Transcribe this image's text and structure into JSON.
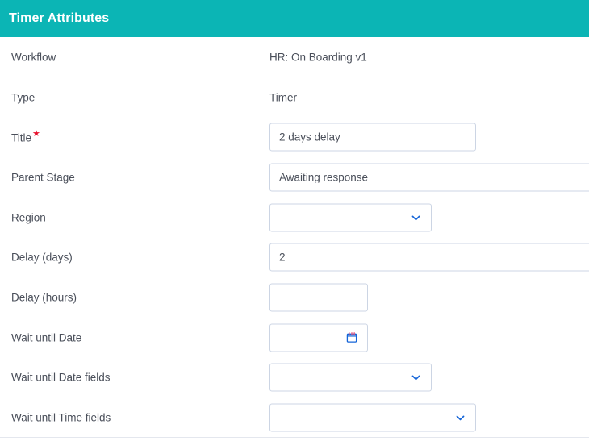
{
  "header": {
    "title": "Timer Attributes",
    "background_color": "#0bb5b5",
    "text_color": "#ffffff"
  },
  "colors": {
    "accent_teal": "#0bb5b5",
    "label_text": "#4a4f5a",
    "input_border": "#ccd5e4",
    "icon_blue": "#1565d8",
    "required_star": "#e8112d",
    "divider": "#e4e7ee"
  },
  "form": {
    "rows": [
      {
        "label": "Workflow",
        "required": false,
        "control": "static",
        "value": "HR: On Boarding v1"
      },
      {
        "label": "Type",
        "required": false,
        "control": "static",
        "value": "Timer"
      },
      {
        "label": "Title",
        "required": true,
        "control": "textbox",
        "value": "2 days delay",
        "placeholder": ""
      },
      {
        "label": "Parent Stage",
        "required": false,
        "control": "textbox",
        "value": "Awaiting response",
        "placeholder": ""
      },
      {
        "label": "Region",
        "required": false,
        "control": "dropdown",
        "value": "",
        "icon": "chevron-down-icon"
      },
      {
        "label": "Delay (days)",
        "required": false,
        "control": "textbox",
        "value": "2",
        "placeholder": ""
      },
      {
        "label": "Delay (hours)",
        "required": false,
        "control": "textbox",
        "value": "",
        "placeholder": ""
      },
      {
        "label": "Wait until Date",
        "required": false,
        "control": "datepicker",
        "value": "",
        "icon": "calendar-icon"
      },
      {
        "label": "Wait until Date fields",
        "required": false,
        "control": "dropdown",
        "value": "",
        "icon": "chevron-down-icon"
      },
      {
        "label": "Wait until Time fields",
        "required": false,
        "control": "dropdown",
        "value": "",
        "icon": "chevron-down-icon"
      }
    ]
  }
}
